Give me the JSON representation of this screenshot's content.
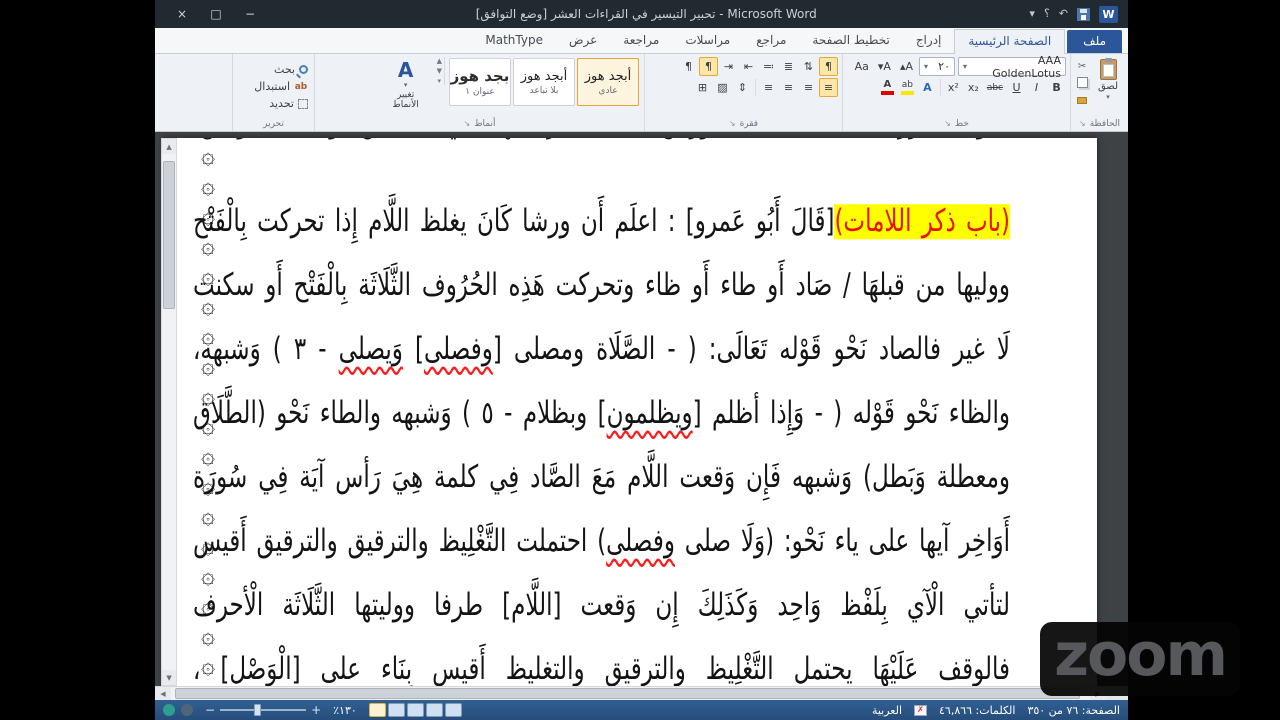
{
  "colors": {
    "accent_blue": "#2b579a",
    "title_bar": "#212931",
    "status_bar": "#2b5380",
    "doc_background": "#3f4245",
    "highlight_yellow": "#ffff00",
    "highlight_text_red": "#e51400"
  },
  "frame": {
    "zoom_watermark": "zoom"
  },
  "title_bar": {
    "title": "تحبير التيسير في القراءات العشر [وضع التوافق] - Microsoft Word"
  },
  "icons": {
    "close": "×",
    "maximize": "□",
    "minimize": "−",
    "chevron_down": "▾",
    "help": "؟",
    "undo": "↶",
    "w_logo": "W",
    "pilcrow": "¶",
    "sort": "⇅",
    "bullets": "≣",
    "numbering": "≔",
    "indent_in": "⇤",
    "indent_out": "⇥",
    "align": "≡",
    "line_spacing": "⇕",
    "shading": "▨",
    "borders": "⊞",
    "bold": "B",
    "italic": "I",
    "underline": "U",
    "strikethrough": "abc",
    "subscript": "x₂",
    "superscript": "x²",
    "text_effects": "A",
    "highlight_letters": "ab",
    "font_color_letter": "A",
    "grow_font": "A▴",
    "shrink_font": "A▾",
    "change_case": "Aa",
    "cut": "✂",
    "dialog_launcher": "↘",
    "scroll_up": "▲",
    "scroll_down": "▼",
    "scroll_left": "◀",
    "scroll_right": "▶",
    "zoom_in": "+",
    "zoom_out": "−",
    "proof_x": "✗"
  },
  "tab_row": {
    "file_tab": "ملف",
    "tabs": [
      "الصفحة الرئيسية",
      "إدراج",
      "تخطيط الصفحة",
      "مراجع",
      "مراسلات",
      "مراجعة",
      "عرض",
      "MathType"
    ],
    "active_tab": "الصفحة الرئيسية"
  },
  "ribbon": {
    "clipboard": {
      "label": "الحافظة",
      "paste": "لصق"
    },
    "font": {
      "label": "خط",
      "font_name": "AAA GoldenLotus",
      "font_size": "٢٠"
    },
    "paragraph": {
      "label": "فقرة"
    },
    "styles": {
      "label": "أنماط",
      "change_styles": "تغيير الأنماط",
      "gallery": [
        {
          "sample": "أبجد هوز",
          "name": "عادي"
        },
        {
          "sample": "أبجد هوز",
          "name": "بلا تباعد"
        },
        {
          "sample": "بجد هوز",
          "name": "عنوان ١"
        }
      ]
    },
    "editing": {
      "label": "تحرير",
      "items": [
        "بحث",
        "استبدال",
        "تحديد"
      ]
    }
  },
  "document": {
    "ornament_glyph": "۞",
    "ornament_count": 19,
    "lines": [
      {
        "class": "clip-top",
        "segments": [
          {
            "t": "نحو (بشرر) على [الغالب] ورش خصت ترجمتها في الحالين وبالله التوفيق."
          }
        ]
      },
      {
        "class": "para-start",
        "segments": [
          {
            "t": "(باب ذكر اللامات)",
            "s": "hl"
          },
          {
            "t": "[قَالَ أَبُو عَمرو] : اعلَم أَن ورشا كَانَ يغلظ اللَّام إِذا تحركت بِالْفَتْح"
          }
        ]
      },
      {
        "class": "",
        "segments": [
          {
            "t": "ووليها من قبلهَا / صَاد أَو طاء أَو ظاء وتحركت هَذِه الحُرُوف الثَّلَاثَة بِالْفَتْح أَو سكنت"
          }
        ]
      },
      {
        "class": "",
        "segments": [
          {
            "t": "لَا غير فالصاد نَحْو قَوْله تَعَالَى: ( - الصَّلَاة ومصلى ["
          },
          {
            "t": "وفصلى",
            "s": "sq"
          },
          {
            "t": "] "
          },
          {
            "t": "وَيصلى",
            "s": "sq"
          },
          {
            "t": " - ٣ ) وَشبهه،"
          }
        ]
      },
      {
        "class": "",
        "segments": [
          {
            "t": "والظاء نَحْو قَوْله ( - وَإِذا أظلم ["
          },
          {
            "t": "ويظلمون",
            "s": "sq"
          },
          {
            "t": "] وبظلام - ٥ ) وَشبهه والطاء نَحْو (الطَّلَاق"
          }
        ]
      },
      {
        "class": "",
        "segments": [
          {
            "t": "ومعطلة وَبَطل) وَشبهه فَإِن وَقعت اللَّام مَعَ الصَّاد فِي كلمة هِيَ رَأس آيَة فِي سُورَة"
          }
        ]
      },
      {
        "class": "",
        "segments": [
          {
            "t": "أَوَاخِر آيها على ياء نَحْو: (وَلَا صلى "
          },
          {
            "t": "وفصلى",
            "s": "sq"
          },
          {
            "t": ") احتملت التَّغْلِيظ والترقيق والترقيق أَقيس"
          }
        ]
      },
      {
        "class": "",
        "segments": [
          {
            "t": "لتأتي الْآي بِلَفْظ وَاحِد وَكَذَلِكَ إِن وَقعت [اللَّام] طرفا ووليتها الثَّلَاثَة الْأحرف"
          }
        ]
      },
      {
        "class": "",
        "segments": [
          {
            "t": "فالوقف عَلَيْهَا يحتمل التَّغْلِيظ والترقيق "
          },
          {
            "t": "والتغليظ",
            "s": "sq"
          },
          {
            "t": " أَقيس بِنَاء على [الْوَصْل] ،"
          }
        ]
      }
    ]
  },
  "status_bar": {
    "page": "الصفحة: ٧٦ من ٣٥٠",
    "words": "الكلمات: ٤٦,٨٦٦",
    "language": "العربية",
    "zoom_percent": "١٣٠٪"
  }
}
